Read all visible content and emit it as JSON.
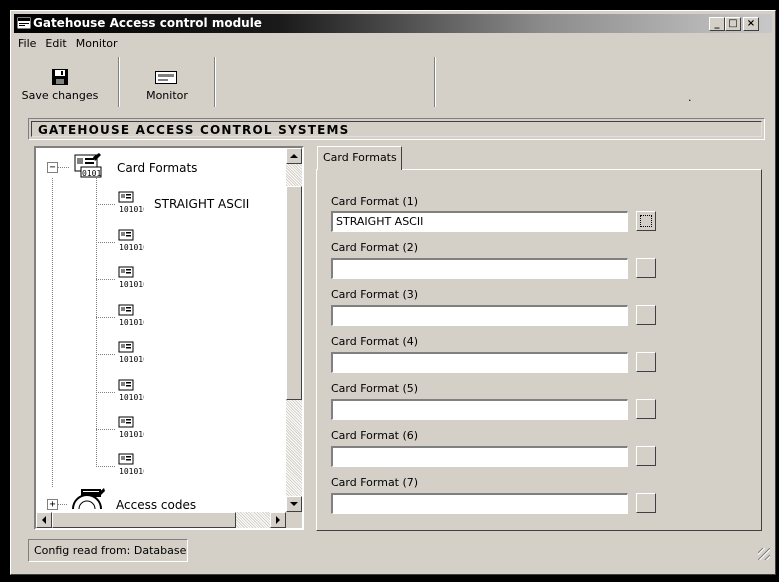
{
  "window": {
    "title": "Gatehouse Access control module",
    "controls": {
      "minimize": "_",
      "maximize": "□",
      "close": "×"
    }
  },
  "menu": [
    "File",
    "Edit",
    "Monitor"
  ],
  "toolbar": {
    "save_label": "Save changes",
    "save_icon": "floppy-disk-icon",
    "monitor_label": "Monitor",
    "monitor_icon": "monitor-icon",
    "trailing_text": "."
  },
  "banner": "GATEHOUSE ACCESS CONTROL SYSTEMS",
  "tree": {
    "root_label": "Card Formats",
    "root_expander": "−",
    "children": [
      "STRAIGHT ASCII",
      "",
      "",
      "",
      "",
      "",
      "",
      ""
    ],
    "icon_text": "101010",
    "second_label": "Access codes",
    "second_expander": "+"
  },
  "tab": {
    "label": "Card Formats"
  },
  "fields": [
    {
      "label": "Card Format (1)",
      "value": "STRAIGHT ASCII"
    },
    {
      "label": "Card Format (2)",
      "value": ""
    },
    {
      "label": "Card Format (3)",
      "value": ""
    },
    {
      "label": "Card Format (4)",
      "value": ""
    },
    {
      "label": "Card Format (5)",
      "value": ""
    },
    {
      "label": "Card Format (6)",
      "value": ""
    },
    {
      "label": "Card Format (7)",
      "value": ""
    }
  ],
  "status": "Config read from: Database",
  "colors": {
    "face": "#d4d0c8",
    "shadow": "#808080",
    "highlight": "#ffffff",
    "title_start": "#000000",
    "title_end": "#c8c8c8"
  }
}
